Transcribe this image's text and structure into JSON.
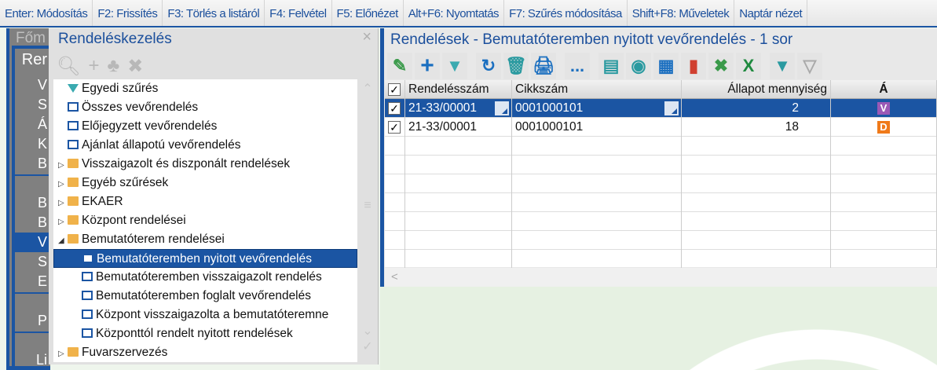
{
  "colors": {
    "accent": "#1b55a3",
    "badge_v": "#9b59b6",
    "badge_d": "#f07a1a"
  },
  "topbar": [
    "Enter: Módosítás",
    "F2: Frissítés",
    "F3: Törlés a listáról",
    "F4: Felvétel",
    "F5: Előnézet",
    "Alt+F6: Nyomtatás",
    "F7: Szűrés módosítása",
    "Shift+F8: Műveletek",
    "Naptár nézet"
  ],
  "left": {
    "header": "Főm",
    "title": "Rer",
    "items": [
      "V",
      "S",
      "Á",
      "K",
      "B",
      "B",
      "B",
      "V",
      "S",
      "E",
      "P",
      "Li"
    ]
  },
  "popup": {
    "title": "Rendeléskezelés",
    "close": "×",
    "tree": [
      {
        "label": "Egyedi szűrés",
        "icon": "filter"
      },
      {
        "label": "Összes vevőrendelés",
        "icon": "monitor"
      },
      {
        "label": "Előjegyzett vevőrendelés",
        "icon": "monitor"
      },
      {
        "label": "Ajánlat állapotú vevőrendelés",
        "icon": "monitor"
      },
      {
        "label": "Visszaigazolt és diszponált rendelések",
        "icon": "folder",
        "arrow": "▷"
      },
      {
        "label": "Egyéb szűrések",
        "icon": "folder",
        "arrow": "▷"
      },
      {
        "label": "EKAER",
        "icon": "folder",
        "arrow": "▷"
      },
      {
        "label": "Központ rendelései",
        "icon": "folder",
        "arrow": "▷"
      },
      {
        "label": "Bemutatóterem rendelései",
        "icon": "folder",
        "arrow": "◢"
      },
      {
        "label": "Bemutatóteremben nyitott vevőrendelés",
        "icon": "monitor"
      },
      {
        "label": "Bemutatóteremben visszaigazolt rendelés",
        "icon": "monitor"
      },
      {
        "label": "Bemutatóteremben foglalt vevőrendelés",
        "icon": "monitor"
      },
      {
        "label": "Központ visszaigazolta a bemutatóteremne",
        "icon": "monitor"
      },
      {
        "label": "Központtól rendelt nyitott rendelések",
        "icon": "monitor"
      },
      {
        "label": "Fuvarszervezés",
        "icon": "folder",
        "arrow": "▷"
      }
    ]
  },
  "right": {
    "title": "Rendelések - Bemutatóteremben nyitott vevőrendelés - 1 sor",
    "more": "...",
    "columns": [
      "Rendelésszám",
      "Cikkszám",
      "Állapot mennyiség",
      "Á"
    ],
    "rows": [
      {
        "rendelesszam": "21-33/00001",
        "cikkszam": "0001000101",
        "mennyiseg": "2",
        "allapot": "V"
      },
      {
        "rendelesszam": "21-33/00001",
        "cikkszam": "0001000101",
        "mennyiseg": "18",
        "allapot": "D"
      }
    ],
    "check": "✓"
  }
}
